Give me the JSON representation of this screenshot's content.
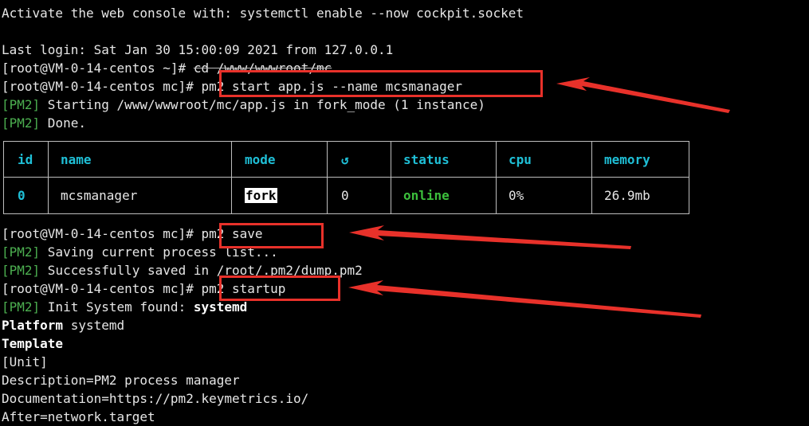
{
  "terminal": {
    "lines": {
      "l1": "Activate the web console with: systemctl enable --now cockpit.socket",
      "l2": "Last login: Sat Jan 30 15:00:09 2021 from 127.0.0.1",
      "l3_prompt": "[root@VM-0-14-centos ~]# ",
      "l3_cmd": "cd /www/wwwroot/mc",
      "l4_prompt": "[root@VM-0-14-centos mc]# ",
      "l4_cmd": "pm2 start app.js --name mcsmanager",
      "l5_tag": "[PM2]",
      "l5_text": " Starting /www/wwwroot/mc/app.js in fork_mode (1 instance)",
      "l6_tag": "[PM2]",
      "l6_text": " Done.",
      "l7_prompt": "[root@VM-0-14-centos mc]# ",
      "l7_cmd": "pm2 save",
      "l8_tag": "[PM2]",
      "l8_text": " Saving current process list...",
      "l9_tag": "[PM2]",
      "l9_text": " Successfully saved in /root/.pm2/dump.pm2",
      "l10_prompt": "[root@VM-0-14-centos mc]# ",
      "l10_cmd": "pm2 startup",
      "l11_tag": "[PM2]",
      "l11_text": " Init System found: ",
      "l11_bold": "systemd",
      "l12_bold": "Platform",
      "l12_text": " systemd",
      "l13_bold": "Template",
      "l14": "[Unit]",
      "l15": "Description=PM2 process manager",
      "l16": "Documentation=https://pm2.keymetrics.io/",
      "l17": "After=network.target"
    },
    "process_table": {
      "headers": [
        "id",
        "name",
        "mode",
        "↺",
        "status",
        "cpu",
        "memory"
      ],
      "row": [
        "0",
        "mcsmanager",
        "fork",
        "0",
        "online",
        "0%",
        "26.9mb"
      ]
    }
  },
  "colors": {
    "background": "#000000",
    "text": "#e6e6e6",
    "pm2_tag": "#4caf50",
    "table_header": "#1fbfd6",
    "status_online": "#3cbf3c",
    "annotation": "#e8312a"
  }
}
